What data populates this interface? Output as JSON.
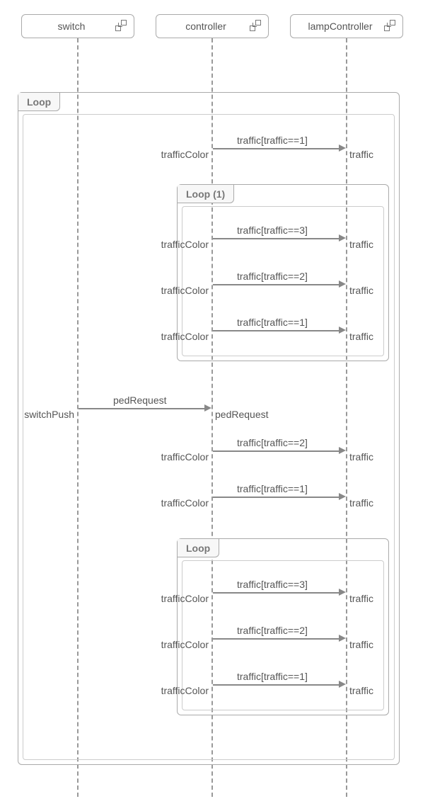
{
  "lifelines": {
    "switch": "switch",
    "controller": "controller",
    "lampController": "lampController"
  },
  "fragments": {
    "outerLoop": "Loop",
    "loop1": "Loop (1)",
    "loop2": "Loop"
  },
  "messages": {
    "m1": {
      "send": "trafficColor",
      "label": "traffic[traffic==1]",
      "recv": "traffic"
    },
    "m2": {
      "send": "trafficColor",
      "label": "traffic[traffic==3]",
      "recv": "traffic"
    },
    "m3": {
      "send": "trafficColor",
      "label": "traffic[traffic==2]",
      "recv": "traffic"
    },
    "m4": {
      "send": "trafficColor",
      "label": "traffic[traffic==1]",
      "recv": "traffic"
    },
    "m5": {
      "send": "switchPush",
      "label": "pedRequest",
      "recv": "pedRequest"
    },
    "m6": {
      "send": "trafficColor",
      "label": "traffic[traffic==2]",
      "recv": "traffic"
    },
    "m7": {
      "send": "trafficColor",
      "label": "traffic[traffic==1]",
      "recv": "traffic"
    },
    "m8": {
      "send": "trafficColor",
      "label": "traffic[traffic==3]",
      "recv": "traffic"
    },
    "m9": {
      "send": "trafficColor",
      "label": "traffic[traffic==2]",
      "recv": "traffic"
    },
    "m10": {
      "send": "trafficColor",
      "label": "traffic[traffic==1]",
      "recv": "traffic"
    }
  },
  "chart_data": {
    "type": "sequence-diagram",
    "lifelines": [
      "switch",
      "controller",
      "lampController"
    ],
    "fragments": [
      {
        "operator": "Loop",
        "contains": [
          {
            "from": "controller",
            "to": "lampController",
            "sendLabel": "trafficColor",
            "guard": "traffic[traffic==1]",
            "recvLabel": "traffic"
          },
          {
            "operator": "Loop (1)",
            "contains": [
              {
                "from": "controller",
                "to": "lampController",
                "sendLabel": "trafficColor",
                "guard": "traffic[traffic==3]",
                "recvLabel": "traffic"
              },
              {
                "from": "controller",
                "to": "lampController",
                "sendLabel": "trafficColor",
                "guard": "traffic[traffic==2]",
                "recvLabel": "traffic"
              },
              {
                "from": "controller",
                "to": "lampController",
                "sendLabel": "trafficColor",
                "guard": "traffic[traffic==1]",
                "recvLabel": "traffic"
              }
            ]
          },
          {
            "from": "switch",
            "to": "controller",
            "sendLabel": "switchPush",
            "guard": "pedRequest",
            "recvLabel": "pedRequest"
          },
          {
            "from": "controller",
            "to": "lampController",
            "sendLabel": "trafficColor",
            "guard": "traffic[traffic==2]",
            "recvLabel": "traffic"
          },
          {
            "from": "controller",
            "to": "lampController",
            "sendLabel": "trafficColor",
            "guard": "traffic[traffic==1]",
            "recvLabel": "traffic"
          },
          {
            "operator": "Loop",
            "contains": [
              {
                "from": "controller",
                "to": "lampController",
                "sendLabel": "trafficColor",
                "guard": "traffic[traffic==3]",
                "recvLabel": "traffic"
              },
              {
                "from": "controller",
                "to": "lampController",
                "sendLabel": "trafficColor",
                "guard": "traffic[traffic==2]",
                "recvLabel": "traffic"
              },
              {
                "from": "controller",
                "to": "lampController",
                "sendLabel": "trafficColor",
                "guard": "traffic[traffic==1]",
                "recvLabel": "traffic"
              }
            ]
          }
        ]
      }
    ]
  }
}
